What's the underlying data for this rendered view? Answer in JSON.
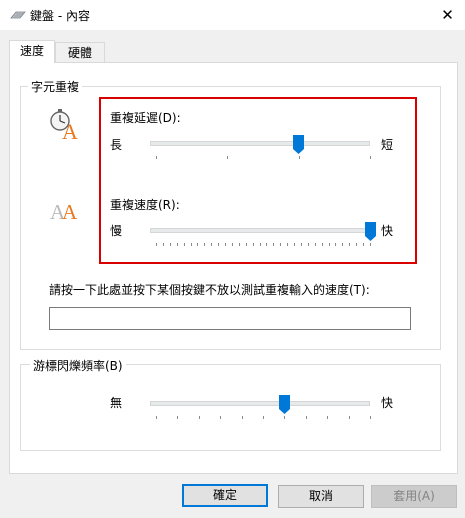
{
  "window": {
    "title": "鍵盤 - 內容",
    "close_glyph": "✕"
  },
  "tabs": [
    {
      "label": "速度",
      "active": true
    },
    {
      "label": "硬體",
      "active": false
    }
  ],
  "repeat_group": {
    "label": "字元重複",
    "delay": {
      "label": "重複延遲(D):",
      "min_label": "長",
      "max_label": "短",
      "ticks": 4,
      "value_fraction": 0.667
    },
    "rate": {
      "label": "重複速度(R):",
      "min_label": "慢",
      "max_label": "快",
      "ticks": 32,
      "value_fraction": 1.0
    },
    "test_label": "請按一下此處並按下某個按鍵不放以測試重複輸入的速度(T):",
    "test_value": ""
  },
  "cursor_group": {
    "label": "游標閃爍頻率(B)",
    "min_label": "無",
    "max_label": "快",
    "ticks": 11,
    "value_fraction": 0.6
  },
  "buttons": {
    "ok": "確定",
    "cancel": "取消",
    "apply": "套用(A)"
  },
  "colors": {
    "accent": "#0078d7",
    "highlight": "#d90000",
    "icon_orange": "#e8791e"
  },
  "icons": {
    "title": "keyboard-icon",
    "delay": "stopwatch-letter-a-icon",
    "rate": "double-letter-a-icon"
  }
}
